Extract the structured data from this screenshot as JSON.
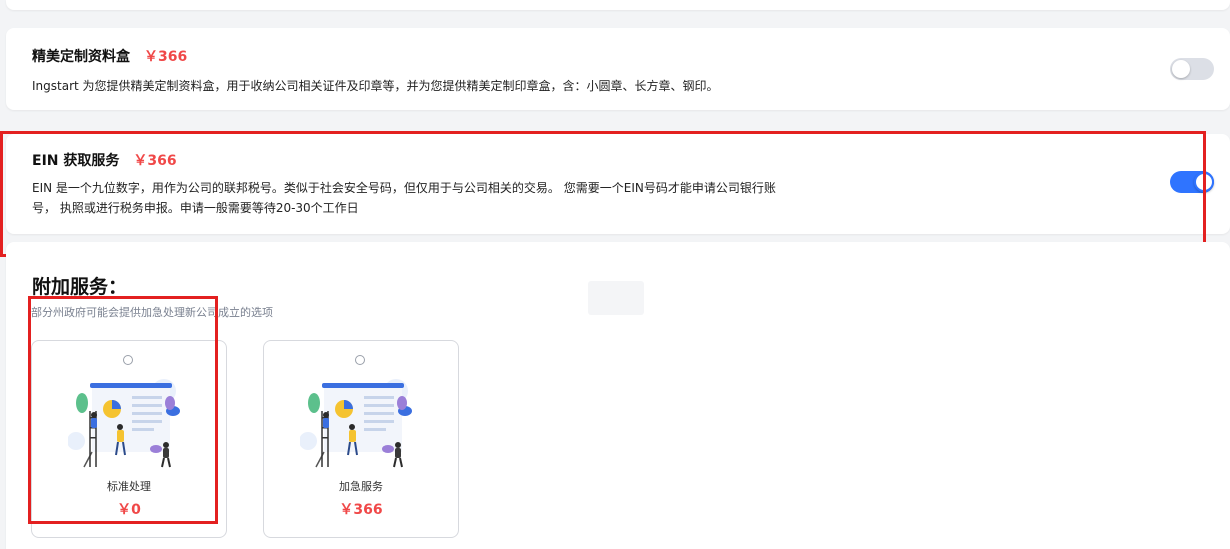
{
  "services": [
    {
      "title": "精美定制资料盒",
      "price": "￥366",
      "description": "Ingstart 为您提供精美定制资料盒，用于收纳公司相关证件及印章等，并为您提供精美定制印章盒，含：小圆章、长方章、钢印。",
      "enabled": false
    },
    {
      "title": "EIN 获取服务",
      "price": "￥366",
      "description_line1": "EIN 是一个九位数字，用作为公司的联邦税号。类似于社会安全号码，但仅用于与公司相关的交易。 您需要一个EIN号码才能申请公司银行账",
      "description_line2": "号， 执照或进行税务申报。申请一般需要等待20-30个工作日",
      "enabled": true
    }
  ],
  "addons": {
    "title": "附加服务：",
    "subtitle": "部分州政府可能会提供加急处理新公司成立的选项",
    "options": [
      {
        "label": "标准处理",
        "price": "￥0",
        "icon": "presentation-team-illustration"
      },
      {
        "label": "加急服务",
        "price": "￥366",
        "icon": "presentation-team-illustration"
      }
    ]
  },
  "colors": {
    "accent": "#2f74ff",
    "price": "#f04848",
    "highlight": "#e32020"
  }
}
